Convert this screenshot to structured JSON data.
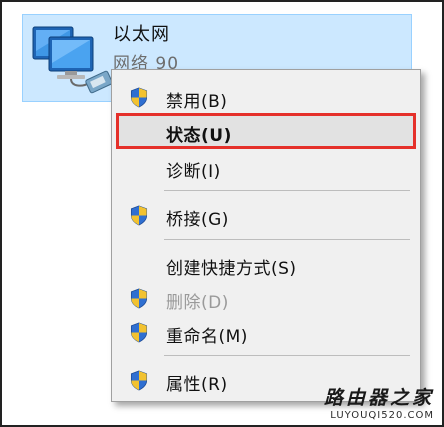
{
  "adapter": {
    "name": "以太网",
    "status": "网络  90",
    "icon": "network-adapter-icon"
  },
  "menu": {
    "items": [
      {
        "label": "禁用(B)",
        "shield": true,
        "disabled": false,
        "bold": false
      },
      {
        "label": "状态(U)",
        "shield": false,
        "disabled": false,
        "bold": true,
        "highlighted": true
      },
      {
        "label": "诊断(I)",
        "shield": false,
        "disabled": false,
        "bold": false
      },
      {
        "label": "桥接(G)",
        "shield": true,
        "disabled": false,
        "bold": false
      },
      {
        "label": "创建快捷方式(S)",
        "shield": false,
        "disabled": false,
        "bold": false
      },
      {
        "label": "删除(D)",
        "shield": true,
        "disabled": true,
        "bold": false
      },
      {
        "label": "重命名(M)",
        "shield": true,
        "disabled": false,
        "bold": false
      },
      {
        "label": "属性(R)",
        "shield": true,
        "disabled": false,
        "bold": false
      }
    ],
    "highlight_color": "#e5302a"
  },
  "watermark": {
    "main": "路由器之家",
    "sub": "LUYOUQI520.COM"
  }
}
